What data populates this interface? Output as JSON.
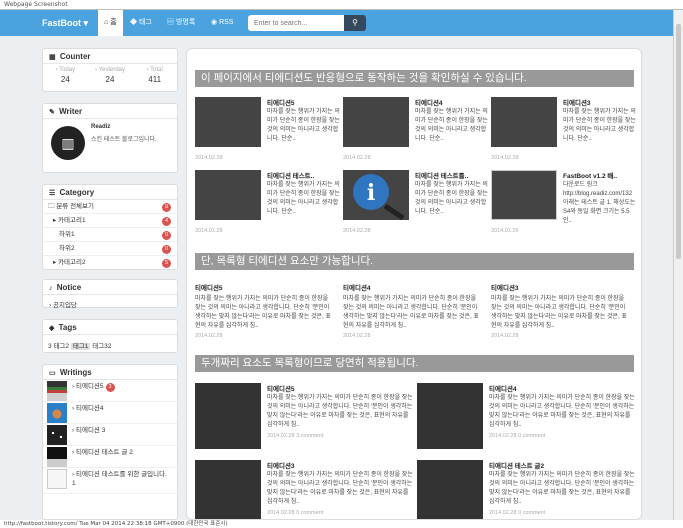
{
  "window": {
    "title": "Webpage Screenshot"
  },
  "status_bar": "http://fastboot.tistory.com/ Tue Mar 04 2014 22:38:18 GMT+0900 (대한민국 표준시)",
  "nav": {
    "brand": "FastBoot",
    "items": [
      {
        "label": "홈",
        "icon": "home-icon"
      },
      {
        "label": "태그",
        "icon": "tag-icon"
      },
      {
        "label": "방명록",
        "icon": "book-icon"
      },
      {
        "label": "RSS",
        "icon": "rss-icon"
      }
    ],
    "search_placeholder": "Enter to search..."
  },
  "counter": {
    "title": "Counter",
    "cells": [
      {
        "label": "Today",
        "value": "24"
      },
      {
        "label": "Yesterday",
        "value": "24"
      },
      {
        "label": "Total",
        "value": "411"
      }
    ]
  },
  "writer": {
    "title": "Writer",
    "name": "Readiz",
    "desc": "스킨 테스트 블로그입니다."
  },
  "category": {
    "title": "Category",
    "rows": [
      {
        "label": "분류 전체보기",
        "count": "9"
      },
      {
        "label": "카테고리1",
        "count": "4"
      },
      {
        "label": "하위1",
        "count": "0"
      },
      {
        "label": "하위2",
        "count": "0"
      },
      {
        "label": "카테고리2",
        "count": "5"
      }
    ]
  },
  "notice": {
    "title": "Notice",
    "items": [
      "공지입당"
    ]
  },
  "tags": {
    "title": "Tags",
    "items": [
      "3",
      "태그2",
      "태그1",
      "태그3",
      "2"
    ]
  },
  "writings": {
    "title": "Writings",
    "items": [
      {
        "label": "티에디션5",
        "badge": "3"
      },
      {
        "label": "티에디션4",
        "badge": ""
      },
      {
        "label": "티에디션 3",
        "badge": ""
      },
      {
        "label": "티에디션 테스트 글 2",
        "badge": ""
      },
      {
        "label": "티에디션 테스트를 위한 글입니다. 1",
        "badge": ""
      }
    ]
  },
  "main": {
    "section1": "이 페이지에서 티에디션도 반응형으로 동작하는 것을 확인하실 수 있습니다.",
    "section2": "단, 목록형 티에디션 요소만 가능합니다.",
    "section3": "두개짜리 요소도 목록형이므로 당연히 적용됩니다.",
    "grid_cards": [
      {
        "title": "티에디션5",
        "desc": "마차를 잦는 행위가 가지는 의미가 단순히 종이 한장을 잦는 것의 의미는 아니라고 생각합니다. 단순..",
        "date": "2014.02.28"
      },
      {
        "title": "티에디션4",
        "desc": "마차를 잦는 행위가 가지는 의미가 단순히 종이 한장을 잦는 것의 의미는 아니라고 생각합니다. 단순..",
        "date": "2014.02.28"
      },
      {
        "title": "티에디션3",
        "desc": "마차를 잦는 행위가 가지는 의미가 단순히 종이 한장을 잦는 것의 의미는 아니라고 생각합니다. 단순..",
        "date": "2014.02.28"
      },
      {
        "title": "티에디션 테스트..",
        "desc": "마차를 잦는 행위가 가지는 의미가 단순히 종이 한장을 잦는 것의 의미는 아니라고 생각합니다. 단순..",
        "date": "2014.02.28"
      },
      {
        "title": "티에디션 테스트를..",
        "desc": "마차를 잦는 행위가 가지는 의미가 단순히 종이 한장을 잦는 것의 의미는 아니라고 생각합니다. 단순..",
        "date": "2014.02.28"
      },
      {
        "title": "FastBoot v1.2 배..",
        "desc": "다운로드 링크 http://blog.readiz.com/132 아래는 테스트 글 1. 해상도는 S4와 동일 화면 크기는 5.5인..",
        "date": "2014.02.26"
      }
    ],
    "text_cards": [
      {
        "title": "티에디션5",
        "desc": "마차를 잦는 행위가 가지는 의미가 단순히 종이 한장을 잦는 것의 의미는 아니라고 생각합니다. 단순히 '분인이 생각하는 맞지 않는다'라는 이유로 마차를 잦는 것은, 표현의 자유를 심각하게 침..",
        "date": "2014.02.28"
      },
      {
        "title": "티에디션4",
        "desc": "마차를 잦는 행위가 가지는 의미가 단순히 종이 한장을 잦는 것의 의미는 아니라고 생각합니다. 단순히 '분인이 생각하는 맞지 않는다'라는 이유로 마차를 잦는 것은, 표현의 자유를 심각하게 침..",
        "date": "2014.02.28"
      },
      {
        "title": "티에디션3",
        "desc": "마차를 잦는 행위가 가지는 의미가 단순히 종이 한장을 잦는 것의 의미는 아니라고 생각합니다. 단순히 '분인이 생각하는 맞지 않는다'라는 이유로 마차를 잦는 것은, 표현의 자유를 심각하게 침..",
        "date": "2014.02.28"
      }
    ],
    "big_cards": [
      {
        "title": "티에디션5",
        "desc": "마차를 잦는 행위가 가지는 의미가 단순히 종이 한장을 잦는 것의 의미는 아니라고 생각합니다. 단순히 '분인이 생각하는 맞지 않는다'라는 이유로 마차를 잦는 것은, 표현의 자유를 심각하게 침..",
        "date": "2014.02.28",
        "comment": "3 comment"
      },
      {
        "title": "티에디션4",
        "desc": "마차를 잦는 행위가 가지는 의미가 단순히 종이 한장을 잦는 것의 의미는 아니라고 생각합니다. 단순히 '분인이 생각하는 맞지 않는다'라는 이유로 마차를 잦는 것은, 표현의 자유를 심각하게 침..",
        "date": "2014.02.28",
        "comment": "0 comment"
      },
      {
        "title": "티에디션3",
        "desc": "마차를 잦는 행위가 가지는 의미가 단순히 종이 한장을 잦는 것의 의미는 아니라고 생각합니다. 단순히 '분인이 생각하는 맞지 않는다'라는 이유로 마차를 잦는 것은, 표현의 자유를 심각하게 침..",
        "date": "2014.02.28",
        "comment": "0 comment"
      },
      {
        "title": "티에디션 테스트 글2",
        "desc": "마차를 잦는 행위가 가지는 의미가 단순히 종이 한장을 잦는 것의 의미는 아니라고 생각합니다. 단순히 '분인이 생각하는 맞지 않는다'라는 이유로 마차를 잦는 것은, 표현의 자유를 심각하게 침..",
        "date": "2014.02.28",
        "comment": "0 comment"
      }
    ]
  },
  "colors": {
    "navbar": "#4aa3df",
    "badge": "#d9534f",
    "section_head": "#999999"
  }
}
